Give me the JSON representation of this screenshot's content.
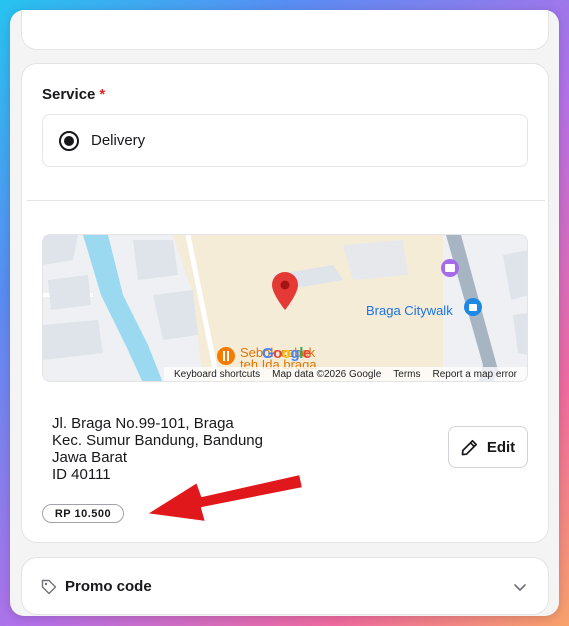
{
  "service": {
    "label": "Service",
    "required_mark": "*",
    "option_label": "Delivery",
    "selected": true
  },
  "map": {
    "place_label": "Braga Citywalk",
    "poi_label_line1": "Sebok cobek",
    "poi_label_line2": "teh Ida braga",
    "logo_text": "Google",
    "attribution": {
      "shortcuts": "Keyboard shortcuts",
      "map_data": "Map data ©2026 Google",
      "terms": "Terms",
      "report": "Report a map error"
    },
    "colors": {
      "marker": "#e53935",
      "water": "#9ad9f0",
      "road": "#a7b5c3",
      "block": "#f5ecd8"
    }
  },
  "address": {
    "line1": "Jl. Braga No.99-101, Braga",
    "line2": "Kec. Sumur Bandung, Bandung",
    "line3": "Jawa Barat",
    "line4": "ID 40111"
  },
  "edit_button_label": "Edit",
  "price_badge": "RP 10.500",
  "promo": {
    "label": "Promo code"
  },
  "annotation": {
    "arrow_color": "#e0181c"
  }
}
